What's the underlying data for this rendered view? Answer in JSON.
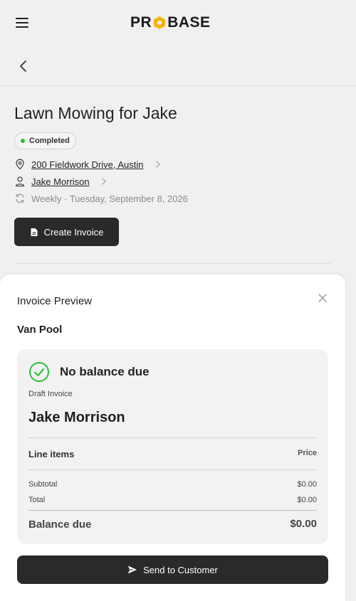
{
  "header": {
    "logo_text_left": "PR",
    "logo_text_right": "BASE"
  },
  "job": {
    "title": "Lawn Mowing for Jake",
    "status": "Completed",
    "address": "200 Fieldwork Drive, Austin",
    "customer": "Jake Morrison",
    "recurrence": "Weekly · Tuesday, September 8, 2026",
    "create_invoice_label": "Create Invoice"
  },
  "invoice_preview": {
    "title": "Invoice Preview",
    "company": "Van Pool",
    "balance_message": "No balance due",
    "draft_label": "Draft Invoice",
    "customer_name": "Jake Morrison",
    "line_items_header": "Line items",
    "price_header": "Price",
    "subtotal_label": "Subtotal",
    "subtotal_value": "$0.00",
    "total_label": "Total",
    "total_value": "$0.00",
    "balance_due_label": "Balance due",
    "balance_due_value": "$0.00",
    "send_label": "Send to Customer"
  },
  "colors": {
    "status_dot": "#2fbf3a",
    "check_green": "#2fbf3a",
    "logo_hex": "#f5b400",
    "button_dark": "#2a2a2a"
  }
}
